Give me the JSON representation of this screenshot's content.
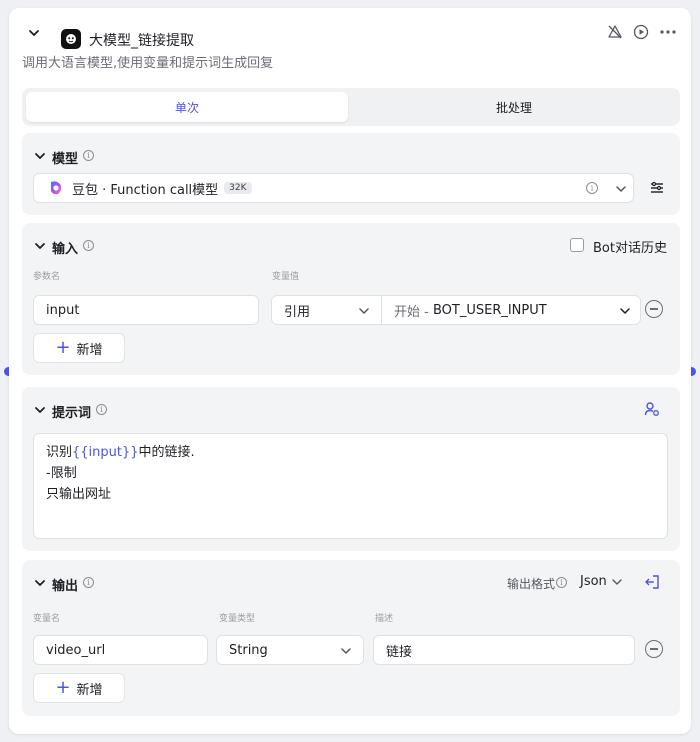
{
  "header": {
    "title": "大模型_链接提取",
    "subtitle": "调用大语言模型,使用变量和提示词生成回复",
    "icons": [
      "chevron-down-icon",
      "bot-logo-icon",
      "debug-off-icon",
      "run-icon",
      "more-icon"
    ]
  },
  "tabs": [
    {
      "label": "单次",
      "active": true
    },
    {
      "label": "批处理",
      "active": false
    }
  ],
  "model": {
    "title": "模型",
    "name": "豆包 · Function call模型",
    "context": "32K"
  },
  "input": {
    "title": "输入",
    "history_label": "Bot对话历史",
    "history_checked": false,
    "col_param": "参数名",
    "col_value": "变量值",
    "param_value": "input",
    "ref_type": "引用",
    "ref_source_prefix": "开始 - ",
    "ref_source_var": "BOT_USER_INPUT",
    "add_label": "新增"
  },
  "prompt": {
    "title": "提示词",
    "line1_before": "识别",
    "line1_var": "{{input}}",
    "line1_after": "中的链接.",
    "line2": "-限制",
    "line3": "只输出网址"
  },
  "output": {
    "title": "输出",
    "format_label": "输出格式",
    "format_value": "Json",
    "col_name": "变量名",
    "col_type": "变量类型",
    "col_desc": "描述",
    "var_name": "video_url",
    "var_type": "String",
    "description": "链接",
    "add_label": "新增"
  },
  "colors": {
    "accent": "#4d53e8",
    "panel_bg": "#f3f4f6"
  }
}
